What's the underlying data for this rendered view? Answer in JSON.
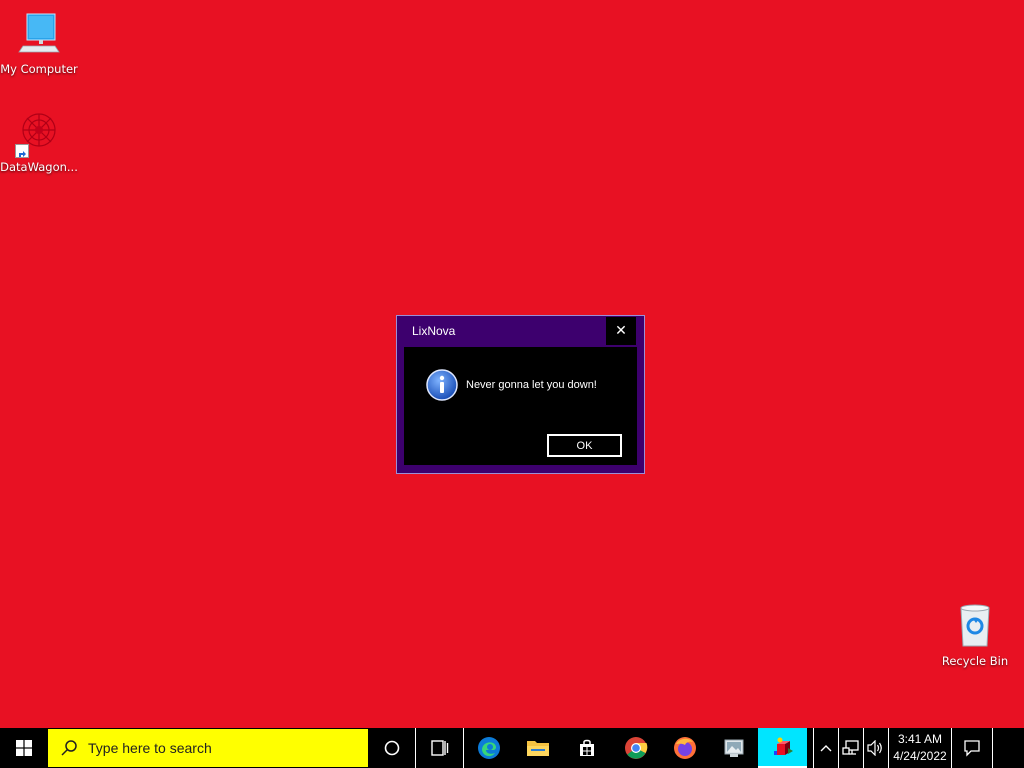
{
  "desktop": {
    "background_color": "#e81123",
    "icons": [
      {
        "label": "My Computer",
        "icon": "computer-icon"
      },
      {
        "label": "DataWagon...",
        "icon": "datawagon-icon"
      },
      {
        "label": "Recycle Bin",
        "icon": "recycle-bin-icon"
      }
    ]
  },
  "dialog": {
    "title": "LixNova",
    "close_label": "✕",
    "icon": "info-icon",
    "message": "Never gonna let you down!",
    "ok_label": "OK"
  },
  "taskbar": {
    "search_placeholder": "Type here to search",
    "apps": [
      {
        "name": "edge",
        "icon": "edge-icon"
      },
      {
        "name": "file-explorer",
        "icon": "folder-icon"
      },
      {
        "name": "store",
        "icon": "store-icon"
      },
      {
        "name": "chrome",
        "icon": "chrome-icon"
      },
      {
        "name": "firefox",
        "icon": "firefox-icon"
      },
      {
        "name": "photos",
        "icon": "photos-icon"
      },
      {
        "name": "active-app",
        "icon": "cube-app-icon"
      }
    ],
    "clock": {
      "time": "3:41 AM",
      "date": "4/24/2022"
    }
  }
}
